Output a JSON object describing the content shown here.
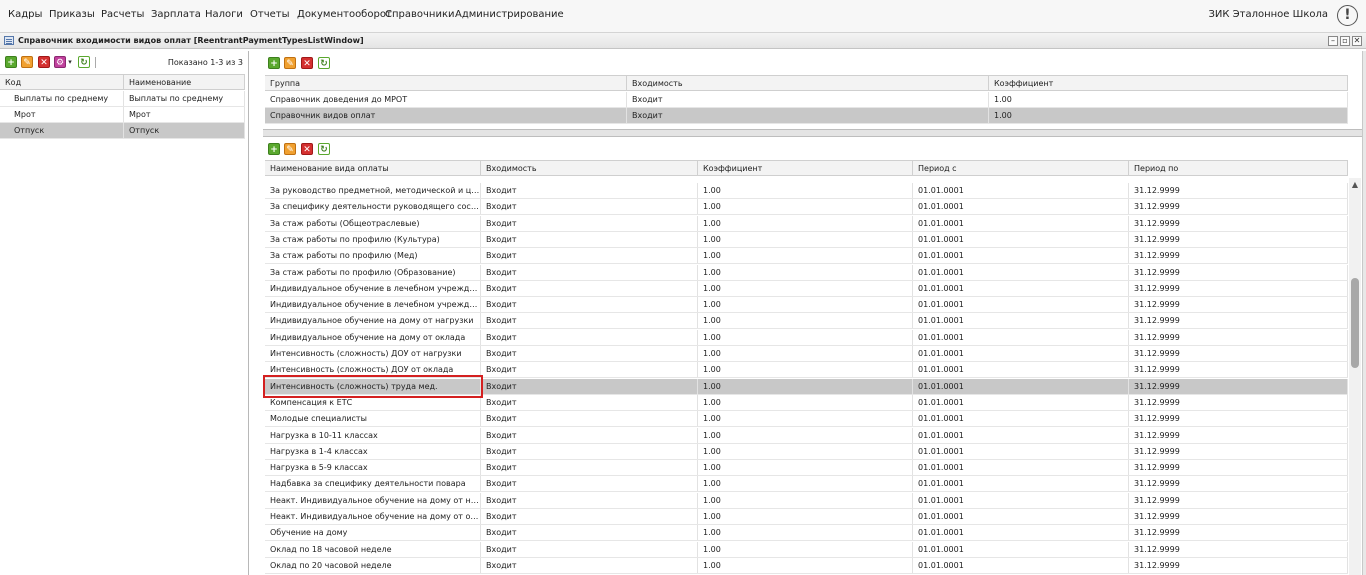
{
  "menu": {
    "items": [
      "Кадры",
      "Приказы",
      "Расчеты",
      "Зарплата",
      "Налоги",
      "Отчеты",
      "Документооборот",
      "Справочники",
      "Администрирование"
    ],
    "org": "ЗИК Эталонное Школа",
    "alert": "!"
  },
  "window": {
    "title": "Справочник входимости видов оплат [ReentrantPaymentTypesListWindow]",
    "minimize": "–",
    "restore": "▫",
    "close": "✕"
  },
  "left": {
    "shown": "Показано 1-3 из 3",
    "headers": [
      "Код",
      "Наименование"
    ],
    "rows": [
      [
        "Выплаты по среднему",
        "Выплаты по среднему"
      ],
      [
        "Мрот",
        "Мрот"
      ],
      [
        "Отпуск",
        "Отпуск"
      ]
    ],
    "selected_row": 2
  },
  "groups": {
    "headers": [
      "Группа",
      "Входимость",
      "Коэффициент"
    ],
    "rows": [
      [
        "Справочник доведения до МРОТ",
        "Входит",
        "1.00"
      ],
      [
        "Справочник видов оплат",
        "Входит",
        "1.00"
      ]
    ],
    "selected_row": 1
  },
  "payments": {
    "headers": [
      "Наименование вида оплаты",
      "Входимость",
      "Коэффициент",
      "Период с",
      "Период по"
    ],
    "rows": [
      [
        "За руководство предметной, методической и цикловой комиссией",
        "Входит",
        "1.00",
        "01.01.0001",
        "31.12.9999"
      ],
      [
        "За специфику деятельности руководящего состава учреждения",
        "Входит",
        "1.00",
        "01.01.0001",
        "31.12.9999"
      ],
      [
        "За стаж работы (Общеотраслевые)",
        "Входит",
        "1.00",
        "01.01.0001",
        "31.12.9999"
      ],
      [
        "За стаж работы по профилю (Культура)",
        "Входит",
        "1.00",
        "01.01.0001",
        "31.12.9999"
      ],
      [
        "За стаж работы по профилю (Мед)",
        "Входит",
        "1.00",
        "01.01.0001",
        "31.12.9999"
      ],
      [
        "За стаж работы по профилю (Образование)",
        "Входит",
        "1.00",
        "01.01.0001",
        "31.12.9999"
      ],
      [
        "Индивидуальное обучение в лечебном учреждении от нагрузки",
        "Входит",
        "1.00",
        "01.01.0001",
        "31.12.9999"
      ],
      [
        "Индивидуальное обучение в лечебном учреждении от оклада",
        "Входит",
        "1.00",
        "01.01.0001",
        "31.12.9999"
      ],
      [
        "Индивидуальное обучение на дому от нагрузки",
        "Входит",
        "1.00",
        "01.01.0001",
        "31.12.9999"
      ],
      [
        "Индивидуальное обучение на дому от оклада",
        "Входит",
        "1.00",
        "01.01.0001",
        "31.12.9999"
      ],
      [
        "Интенсивность (сложность) ДОУ от нагрузки",
        "Входит",
        "1.00",
        "01.01.0001",
        "31.12.9999"
      ],
      [
        "Интенсивность (сложность) ДОУ от оклада",
        "Входит",
        "1.00",
        "01.01.0001",
        "31.12.9999"
      ],
      [
        "Интенсивность (сложность) труда мед.",
        "Входит",
        "1.00",
        "01.01.0001",
        "31.12.9999"
      ],
      [
        "Компенсация к ЕТС",
        "Входит",
        "1.00",
        "01.01.0001",
        "31.12.9999"
      ],
      [
        "Молодые специалисты",
        "Входит",
        "1.00",
        "01.01.0001",
        "31.12.9999"
      ],
      [
        "Нагрузка в 10-11 классах",
        "Входит",
        "1.00",
        "01.01.0001",
        "31.12.9999"
      ],
      [
        "Нагрузка в 1-4 классах",
        "Входит",
        "1.00",
        "01.01.0001",
        "31.12.9999"
      ],
      [
        "Нагрузка в 5-9 классах",
        "Входит",
        "1.00",
        "01.01.0001",
        "31.12.9999"
      ],
      [
        "Надбавка за специфику деятельности повара",
        "Входит",
        "1.00",
        "01.01.0001",
        "31.12.9999"
      ],
      [
        "Неакт. Индивидуальное обучение на дому от нагрузки",
        "Входит",
        "1.00",
        "01.01.0001",
        "31.12.9999"
      ],
      [
        "Неакт. Индивидуальное обучение на дому от оклада",
        "Входит",
        "1.00",
        "01.01.0001",
        "31.12.9999"
      ],
      [
        "Обучение на дому",
        "Входит",
        "1.00",
        "01.01.0001",
        "31.12.9999"
      ],
      [
        "Оклад по 18 часовой неделе",
        "Входит",
        "1.00",
        "01.01.0001",
        "31.12.9999"
      ],
      [
        "Оклад по 20 часовой неделе",
        "Входит",
        "1.00",
        "01.01.0001",
        "31.12.9999"
      ]
    ],
    "selected_row": 12
  },
  "icons": {
    "add": "add-icon",
    "edit": "edit-icon",
    "delete": "delete-icon",
    "settings": "settings-icon",
    "refresh": "refresh-icon"
  },
  "colors": {
    "selected_row": "#c8c8c8",
    "highlight_box": "#d42020",
    "add": "#5aa82e",
    "edit": "#f0a030",
    "delete": "#d43030"
  }
}
